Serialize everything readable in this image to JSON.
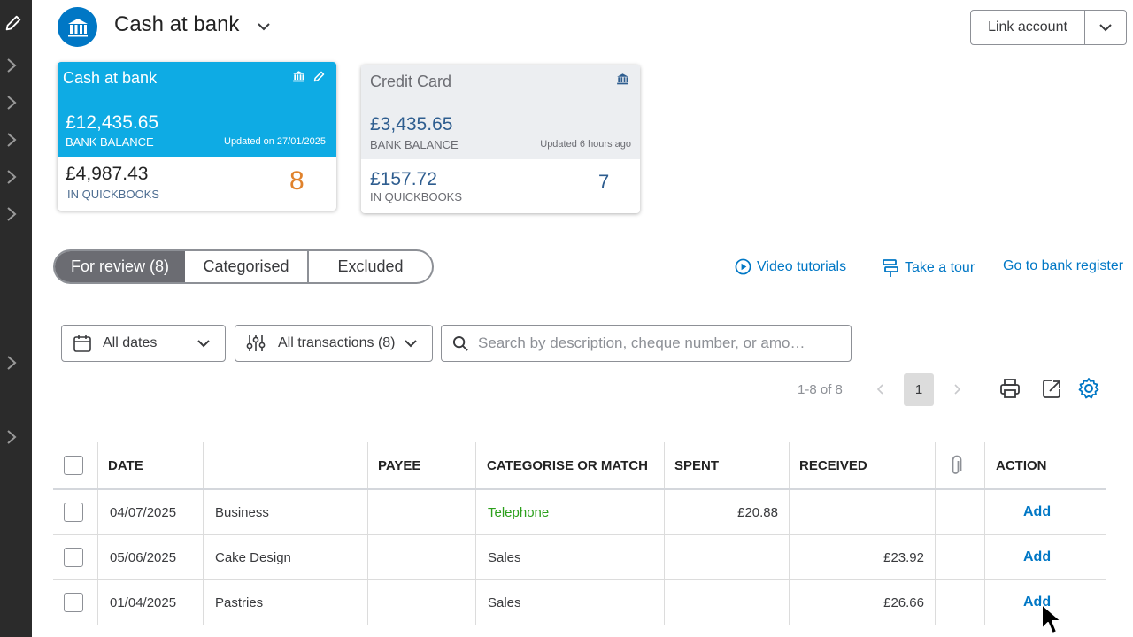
{
  "header": {
    "title": "Cash at bank",
    "link_account": "Link account"
  },
  "cards": [
    {
      "name": "Cash at bank",
      "bank_balance": "£12,435.65",
      "bank_balance_label": "BANK BALANCE",
      "updated": "Updated on 27/01/2025",
      "quickbooks_balance": "£4,987.43",
      "quickbooks_label": "IN QUICKBOOKS",
      "count": "8",
      "color": "#0eabe4"
    },
    {
      "name": "Credit Card",
      "bank_balance": "£3,435.65",
      "bank_balance_label": "BANK BALANCE",
      "updated": "Updated 6 hours ago",
      "quickbooks_balance": "£157.72",
      "quickbooks_label": "IN QUICKBOOKS",
      "count": "7",
      "color": "#eceef1"
    }
  ],
  "tabs": [
    {
      "label": "For review (8)",
      "active": true
    },
    {
      "label": "Categorised",
      "active": false
    },
    {
      "label": "Excluded",
      "active": false
    }
  ],
  "links": {
    "video": "Video tutorials",
    "tour": "Take a tour",
    "register": "Go to bank register"
  },
  "filters": {
    "dates": "All dates",
    "transactions": "All transactions (8)",
    "search_placeholder": "Search by description, cheque number, or amo…"
  },
  "pagination": {
    "range": "1-8 of 8",
    "current": "1"
  },
  "table": {
    "columns": [
      "DATE",
      "",
      "PAYEE",
      "CATEGORISE OR MATCH",
      "SPENT",
      "RECEIVED",
      "",
      "ACTION"
    ],
    "rows": [
      {
        "date": "04/07/2025",
        "description": "Business",
        "payee": "",
        "category": "Telephone",
        "spent": "£20.88",
        "received": "",
        "action": "Add"
      },
      {
        "date": "05/06/2025",
        "description": "Cake Design",
        "payee": "",
        "category": "Sales",
        "spent": "",
        "received": "£23.92",
        "action": "Add"
      },
      {
        "date": "01/04/2025",
        "description": "Pastries",
        "payee": "",
        "category": "Sales",
        "spent": "",
        "received": "£26.66",
        "action": "Add"
      }
    ]
  },
  "colors": {
    "accent": "#0077c5",
    "category_suggested": "#2ca01c",
    "pending_count": "#e0822c"
  },
  "icons": [
    "pencil-icon",
    "chevron-right-icon",
    "bank-icon",
    "chevron-down-icon",
    "calendar-icon",
    "filter-sliders-icon",
    "search-icon",
    "play-circle-icon",
    "signpost-icon",
    "print-icon",
    "export-icon",
    "gear-icon",
    "paperclip-icon",
    "cursor-icon"
  ]
}
